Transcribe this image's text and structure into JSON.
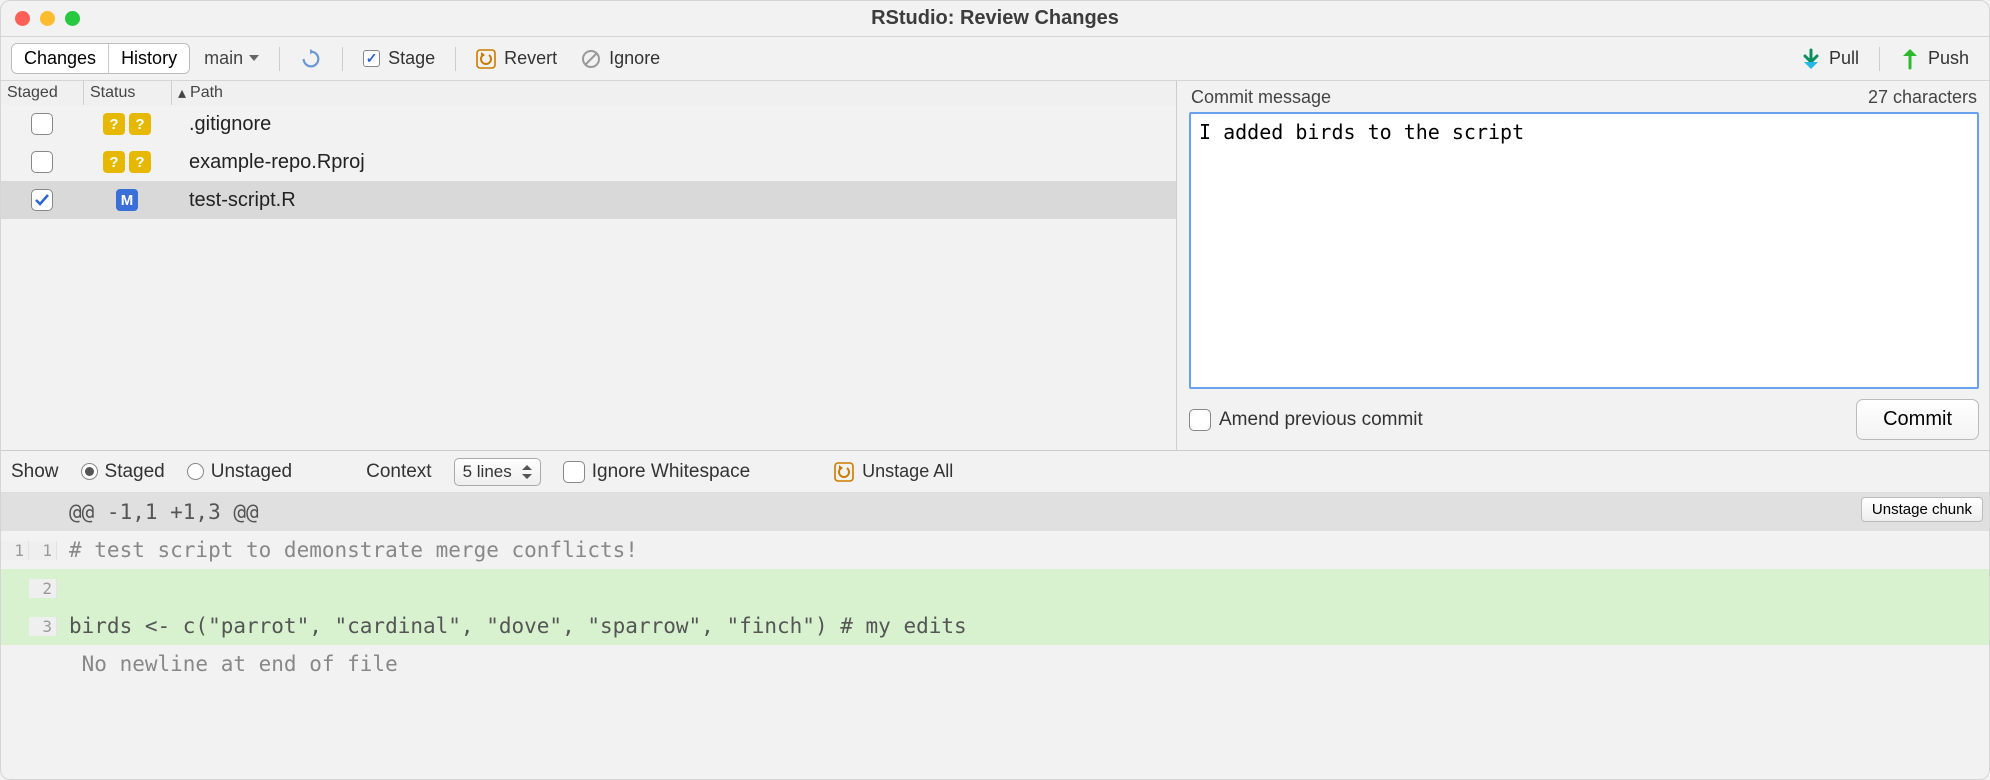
{
  "window": {
    "title": "RStudio: Review Changes"
  },
  "tabs": {
    "changes": "Changes",
    "history": "History"
  },
  "branch": {
    "name": "main"
  },
  "toolbar": {
    "stage": "Stage",
    "revert": "Revert",
    "ignore": "Ignore",
    "pull": "Pull",
    "push": "Push"
  },
  "file_header": {
    "staged": "Staged",
    "status": "Status",
    "path_sort": "▴",
    "path": "Path"
  },
  "files": [
    {
      "staged": false,
      "status": [
        "?",
        "?"
      ],
      "status_kind": "q",
      "path": ".gitignore",
      "selected": false
    },
    {
      "staged": false,
      "status": [
        "?",
        "?"
      ],
      "status_kind": "q",
      "path": "example-repo.Rproj",
      "selected": false
    },
    {
      "staged": true,
      "status": [
        "M"
      ],
      "status_kind": "m",
      "path": "test-script.R",
      "selected": true
    }
  ],
  "commit": {
    "label": "Commit message",
    "count_label": "27 characters",
    "message": "I added birds to the script",
    "amend": "Amend previous commit",
    "button": "Commit"
  },
  "diffbar": {
    "show": "Show",
    "staged": "Staged",
    "unstaged": "Unstaged",
    "context": "Context",
    "context_value": "5 lines",
    "ignore_ws": "Ignore Whitespace",
    "unstage_all": "Unstage All"
  },
  "diff": {
    "hunk": "@@ -1,1 +1,3 @@",
    "unstage_chunk": "Unstage chunk",
    "lines": [
      {
        "old": "1",
        "new": "1",
        "kind": "ctx",
        "text": "# test script to demonstrate merge conflicts!"
      },
      {
        "old": "",
        "new": "2",
        "kind": "add",
        "text": ""
      },
      {
        "old": "",
        "new": "3",
        "kind": "add",
        "text": "birds <- c(\"parrot\", \"cardinal\", \"dove\", \"sparrow\", \"finch\") # my edits"
      },
      {
        "old": "",
        "new": "",
        "kind": "noeol",
        "text": " No newline at end of file"
      }
    ]
  },
  "colors": {
    "traffic_close": "#ff5f57",
    "traffic_min": "#febc2e",
    "traffic_max": "#28c840"
  }
}
